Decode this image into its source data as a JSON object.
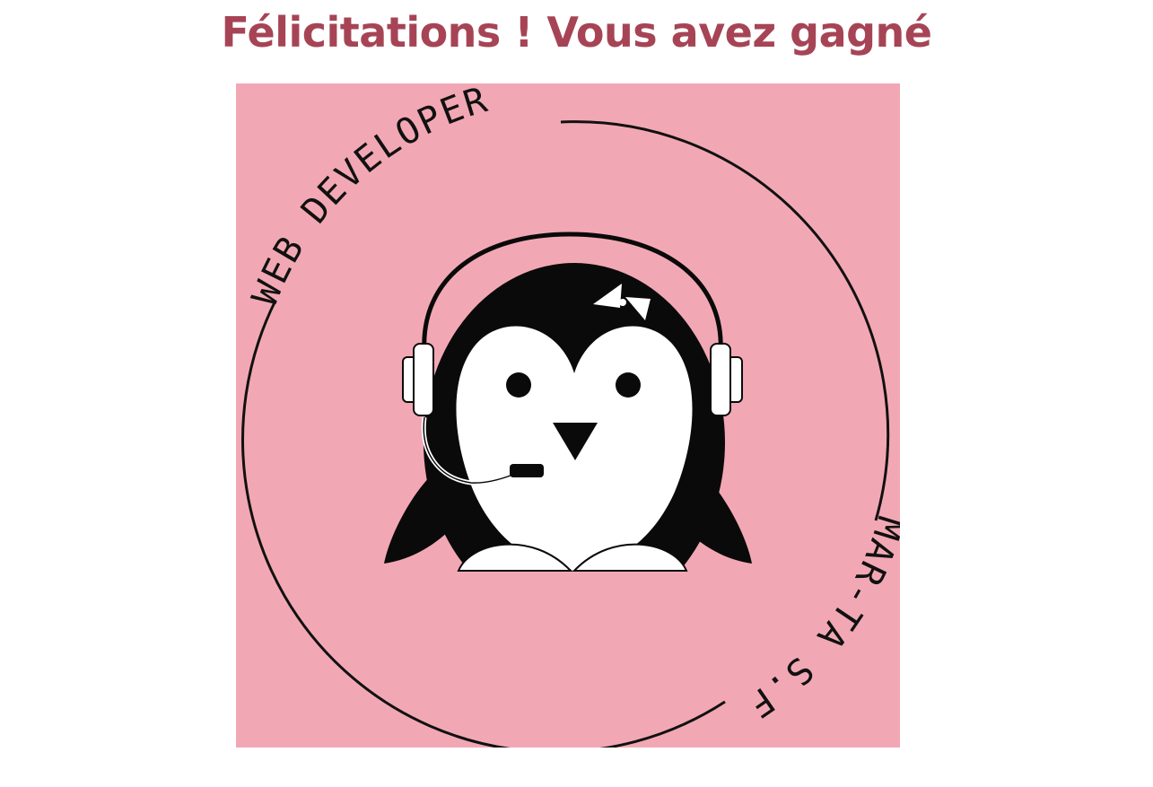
{
  "heading": {
    "text": "Félicitations ! Vous avez gagné"
  },
  "logo": {
    "background_color": "#f2a8b4",
    "ring_top_text": "WEB DEVELOPER",
    "ring_bottom_text": "MAR-TA S.F",
    "mascot": "penguin-with-headset-icon",
    "accessory": "bow-icon"
  },
  "colors": {
    "heading": "#a64456",
    "ink": "#111111",
    "white": "#ffffff"
  }
}
